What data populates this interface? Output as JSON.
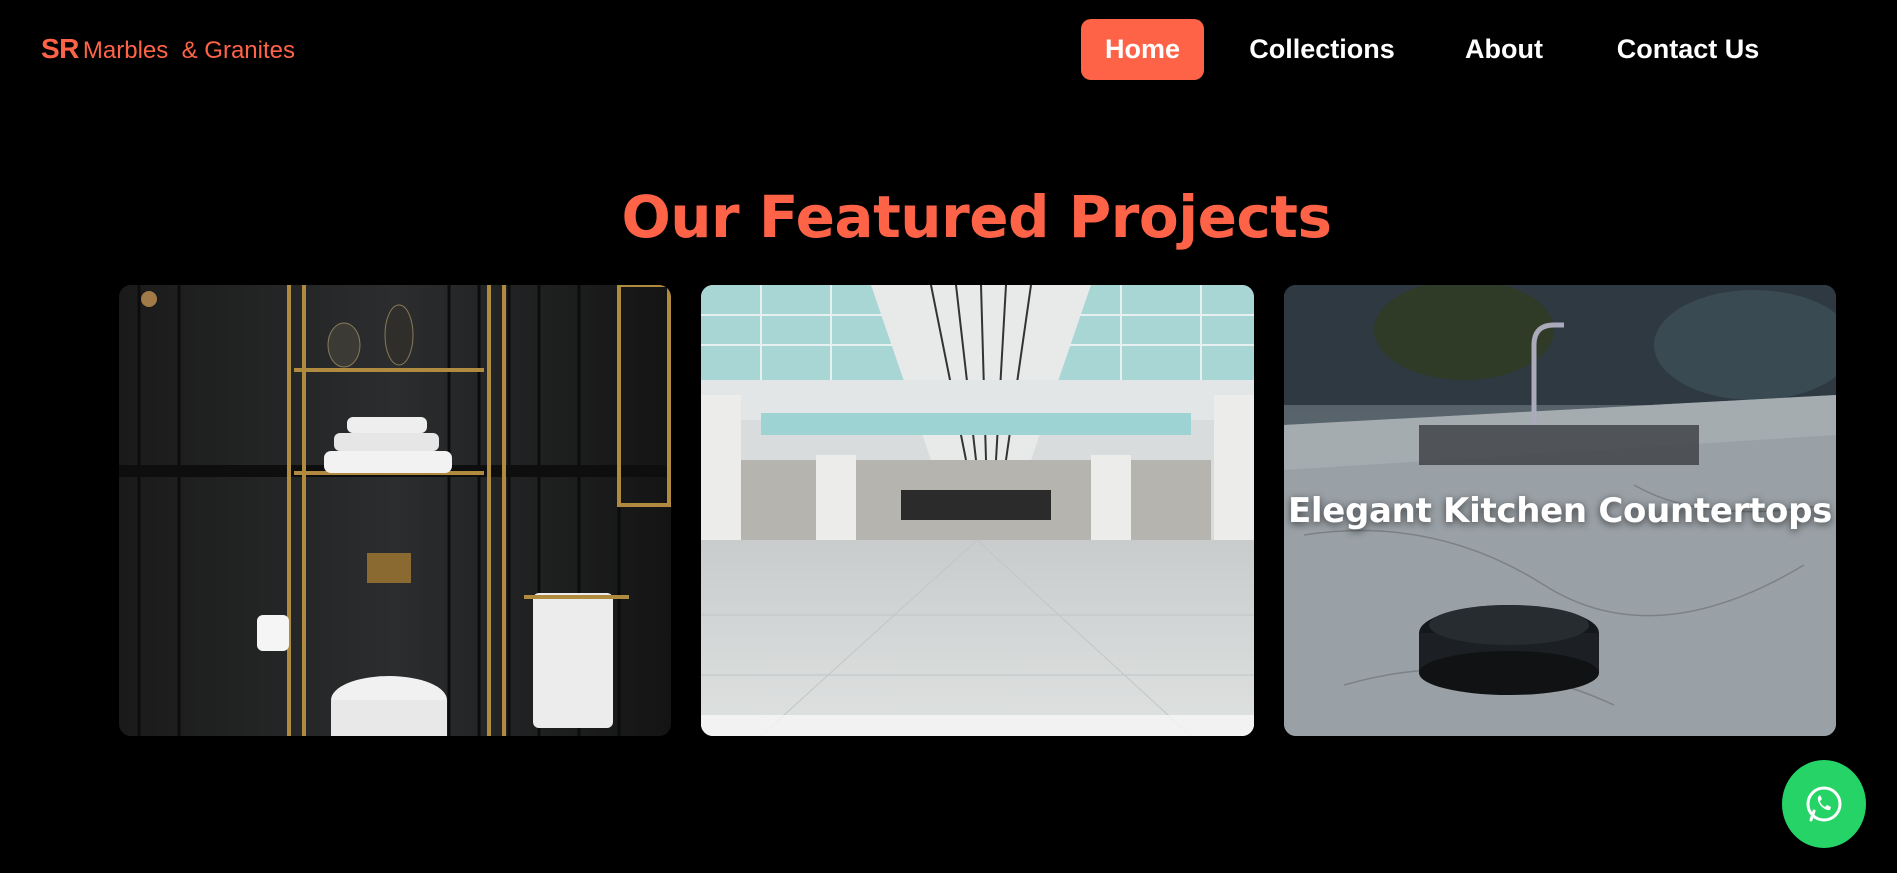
{
  "brand": {
    "logo_bold": "SR",
    "logo_text": "Marbles  & Granites",
    "accent_color": "#ff6347"
  },
  "nav": {
    "items": [
      {
        "label": "Home",
        "active": true
      },
      {
        "label": "Collections",
        "active": false
      },
      {
        "label": "About",
        "active": false
      },
      {
        "label": "Contact Us",
        "active": false
      }
    ]
  },
  "featured": {
    "title": "Our Featured Projects",
    "cards": [
      {
        "image": "luxury-black-bathroom-photo",
        "caption": ""
      },
      {
        "image": "polished-granite-hall-photo",
        "caption": ""
      },
      {
        "image": "marble-kitchen-countertop-photo",
        "caption": "Elegant Kitchen Countertops"
      }
    ]
  },
  "floating_button": {
    "icon": "whatsapp-icon",
    "color": "#25d366"
  }
}
